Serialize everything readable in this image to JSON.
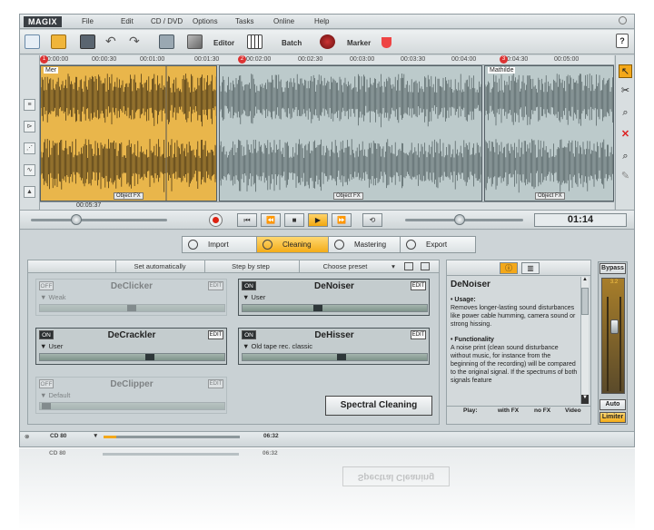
{
  "app": {
    "logo": "MAGIX"
  },
  "menu": [
    "File",
    "Edit",
    "CD / DVD",
    "Options",
    "Tasks",
    "Online",
    "Help"
  ],
  "toolbar": {
    "editor_label": "Editor",
    "batch_label": "Batch",
    "marker_label": "Marker",
    "help_label": "?"
  },
  "ruler": {
    "ticks": [
      "00:00:00",
      "00:00:30",
      "00:01:00",
      "00:01:30",
      "00:02:00",
      "00:02:30",
      "00:03:00",
      "00:03:30",
      "00:04:00",
      "00:04:30",
      "00:05:00"
    ],
    "markers": [
      "1",
      "2",
      "3"
    ]
  },
  "tracks": {
    "objects": [
      {
        "name": "Mer",
        "fx": "Object FX",
        "state": "selected"
      },
      {
        "name": "",
        "fx": "Object FX",
        "state": "normal"
      },
      {
        "name": "Mathilde",
        "fx": "Object FX",
        "state": "normal"
      }
    ],
    "position": "00:05:37"
  },
  "transport": {
    "time": "01:14",
    "buttons": [
      "⏮",
      "⏪",
      "■",
      "▶",
      "⏩"
    ]
  },
  "tabs": [
    {
      "label": "Import",
      "active": false
    },
    {
      "label": "Cleaning",
      "active": true
    },
    {
      "label": "Mastering",
      "active": false
    },
    {
      "label": "Export",
      "active": false
    }
  ],
  "cleaning": {
    "set_auto": "Set automatically",
    "step": "Step by step",
    "choose_preset": "Choose preset",
    "effects": [
      {
        "name": "DeClicker",
        "state": "OFF",
        "preset": "Weak",
        "edit": "EDIT",
        "enabled": false
      },
      {
        "name": "DeNoiser",
        "state": "ON",
        "preset": "User",
        "edit": "EDIT",
        "enabled": true
      },
      {
        "name": "DeCrackler",
        "state": "ON",
        "preset": "User",
        "edit": "EDIT",
        "enabled": true
      },
      {
        "name": "DeHisser",
        "state": "ON",
        "preset": "Old tape rec. classic",
        "edit": "EDIT",
        "enabled": true
      },
      {
        "name": "DeClipper",
        "state": "OFF",
        "preset": "Default",
        "edit": "EDIT",
        "enabled": false
      }
    ],
    "spectral": "Spectral Cleaning"
  },
  "info": {
    "title": "DeNoiser",
    "usage_h": "• Usage:",
    "usage": "Removes longer-lasting sound disturbances like power cable humming, camera sound or strong hissing.",
    "func_h": "• Functionality",
    "func": "A noise print (clean sound disturbance without music, for instance from the beginning of the recording) will be compared to the original signal. If the spectrums of both signals feature",
    "play": [
      "Play:",
      "with FX",
      "no FX",
      "Video"
    ]
  },
  "master": {
    "bypass": "Bypass",
    "level": "3.2",
    "auto": "Auto",
    "limiter": "Limiter"
  },
  "status": {
    "row1_name": "CD 80",
    "row1_time": "06:32",
    "row2_name": "CD 80",
    "row2_time": "06:32"
  }
}
